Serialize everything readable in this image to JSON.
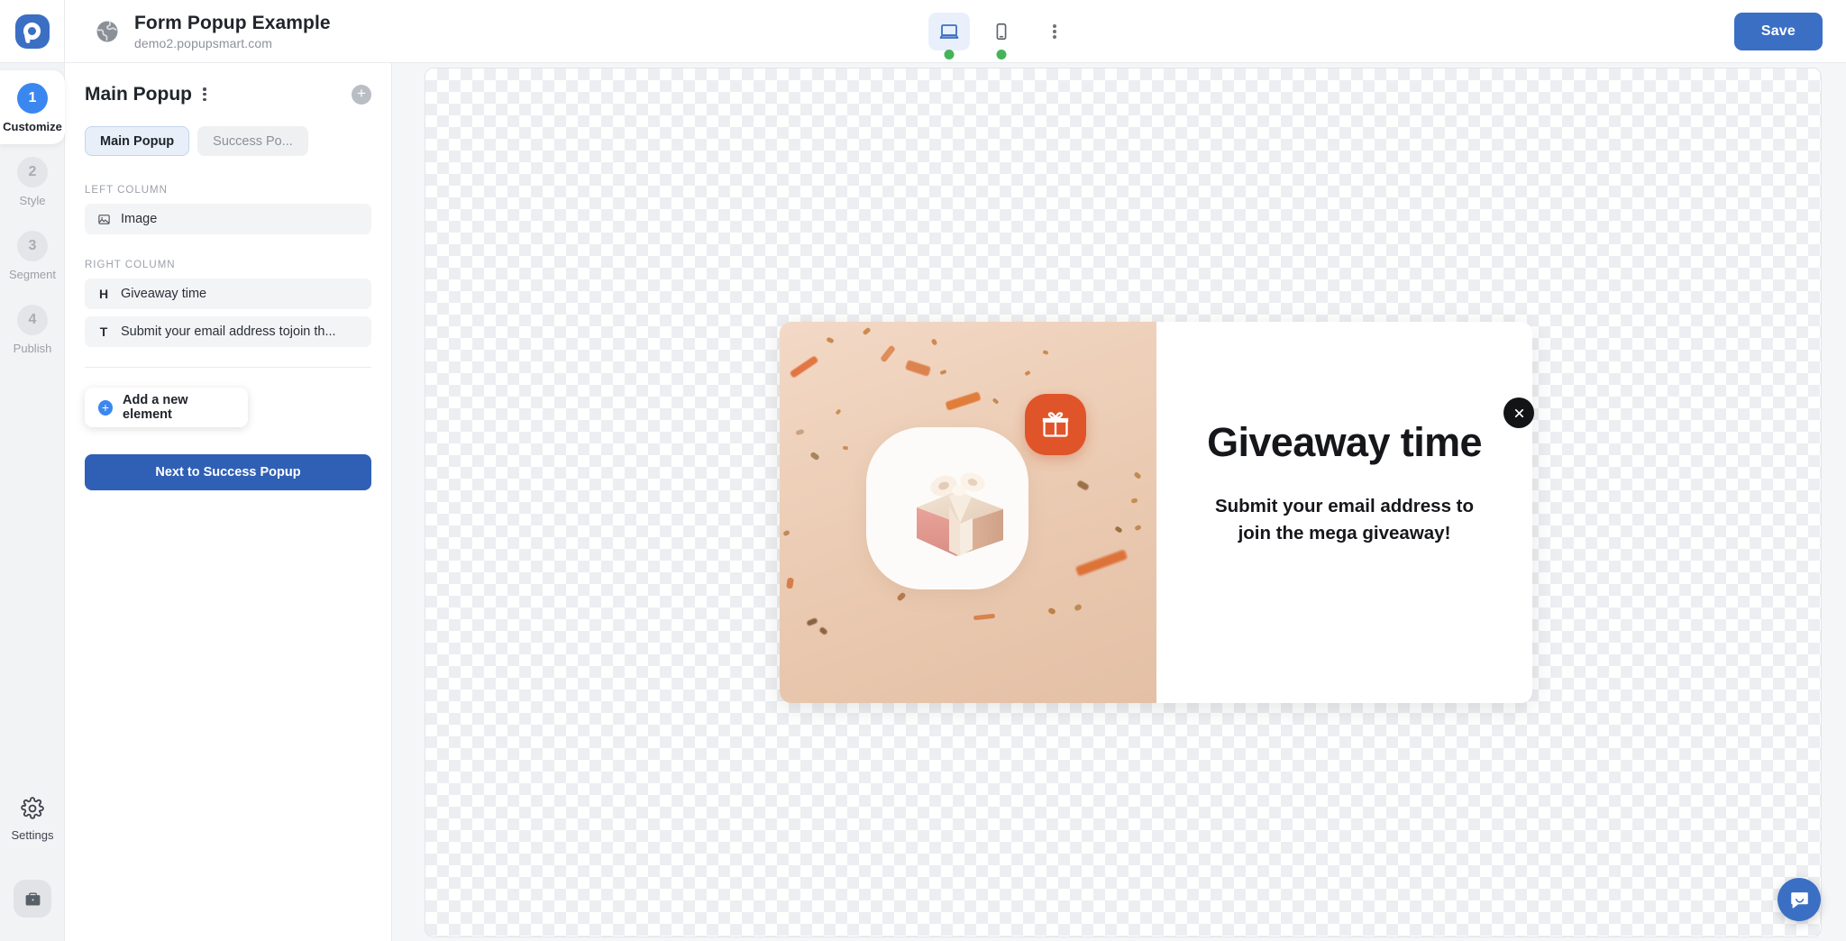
{
  "topbar": {
    "logo_icon": "popupsmart-logo-icon",
    "globe_icon": "globe-icon",
    "site_title": "Form Popup Example",
    "site_url": "demo2.popupsmart.com",
    "devices": [
      {
        "name": "desktop",
        "icon": "desktop-icon",
        "active": true,
        "status": "online"
      },
      {
        "name": "mobile",
        "icon": "mobile-icon",
        "active": false,
        "status": "online"
      }
    ],
    "more_icon": "kebab-menu-icon",
    "save_label": "Save",
    "accent_color": "#3b6fc4",
    "status_dot_color": "#45b459"
  },
  "rail": {
    "steps": [
      {
        "num": "1",
        "label": "Customize",
        "active": true
      },
      {
        "num": "2",
        "label": "Style",
        "active": false
      },
      {
        "num": "3",
        "label": "Segment",
        "active": false
      },
      {
        "num": "4",
        "label": "Publish",
        "active": false
      }
    ],
    "settings_label": "Settings",
    "settings_icon": "gear-icon",
    "kit_icon": "briefcase-icon"
  },
  "panel": {
    "title": "Main Popup",
    "kebab_icon": "kebab-menu-icon",
    "add_icon": "plus-circle-icon",
    "tabs": [
      {
        "label": "Main Popup",
        "active": true
      },
      {
        "label": "Success Po...",
        "active": false
      }
    ],
    "sections": [
      {
        "label": "LEFT COLUMN",
        "elements": [
          {
            "icon": "image-icon",
            "icon_kind": "image",
            "label": "Image"
          }
        ]
      },
      {
        "label": "RIGHT COLUMN",
        "elements": [
          {
            "icon": "heading-icon",
            "icon_kind": "letter",
            "icon_letter": "H",
            "label": "Giveaway time"
          },
          {
            "icon": "text-icon",
            "icon_kind": "letter",
            "icon_letter": "T",
            "label": "Submit your email address tojoin th..."
          }
        ]
      }
    ],
    "add_element_label": "Add a new element",
    "next_label": "Next to Success Popup"
  },
  "popup": {
    "heading": "Giveaway time",
    "subheading_line1": "Submit your email address to",
    "subheading_line2": "join the mega giveaway!",
    "close_icon": "close-icon",
    "badge_icon": "gift-icon",
    "image_icon": "gift-box-3d-image",
    "bg_color": "#ecccb4",
    "badge_color": "#e0542a",
    "panel_color": "#ffffff"
  },
  "chat": {
    "icon": "chat-bubble-icon",
    "color": "#3b6fc4"
  }
}
